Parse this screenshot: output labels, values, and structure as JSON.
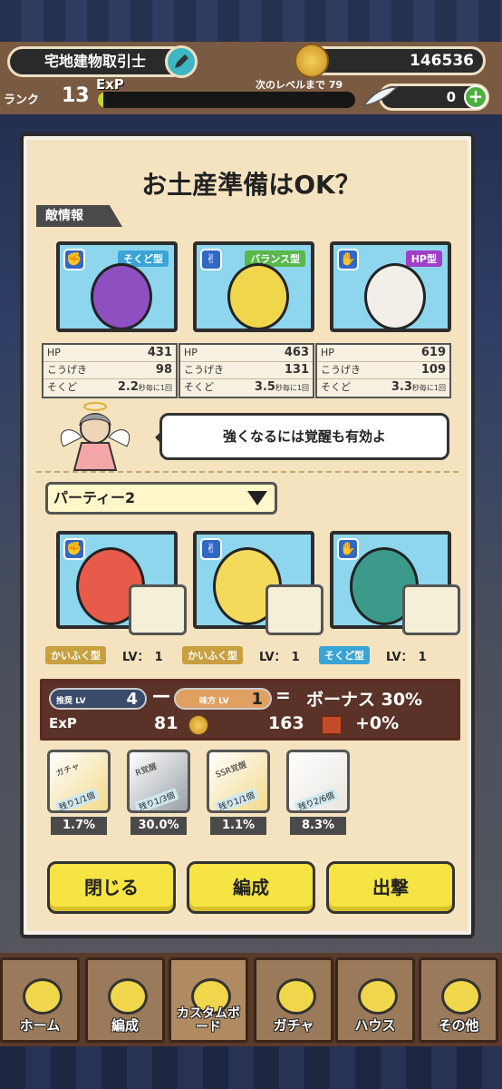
{
  "header": {
    "title": "宅地建物取引士",
    "coins": "146536",
    "rank_label": "ランク",
    "rank": "13",
    "exp_label": "ExP",
    "next_level_label": "次のレベルまで 79",
    "exp_progress": 0.02,
    "feathers": "0"
  },
  "modal": {
    "title": "お土産準備はOK？",
    "enemy_section": "敵情報",
    "enemies": [
      {
        "type": "そくど型",
        "type_color": "#3aa4d6",
        "hand": "✊",
        "hp": "431",
        "attack": "98",
        "speed": "2.2",
        "face_color": "#8e4fc1"
      },
      {
        "type": "バランス型",
        "type_color": "#58b84c",
        "hand": "✌",
        "hp": "463",
        "attack": "131",
        "speed": "3.5",
        "face_color": "#f0d64a"
      },
      {
        "type": "HP型",
        "type_color": "#a040c8",
        "hand": "✋",
        "hp": "619",
        "attack": "109",
        "speed": "3.3",
        "face_color": "#f2efe9"
      }
    ],
    "stat_labels": {
      "hp": "HP",
      "attack": "こうげき",
      "speed": "そくど",
      "speed_unit": "秒毎に1回"
    },
    "tip": "強くなるには覚醒も有効よ",
    "party_select": "パーティー2",
    "party": [
      {
        "type": "かいふく型",
        "type_color": "#c8a040",
        "lv_label": "LV：",
        "lv": "1",
        "hand": "✊",
        "face_color": "#e85a4a"
      },
      {
        "type": "かいふく型",
        "type_color": "#c8a040",
        "lv_label": "LV：",
        "lv": "1",
        "hand": "✌",
        "face_color": "#f3da5a"
      },
      {
        "type": "そくど型",
        "type_color": "#3aa4d6",
        "lv_label": "LV：",
        "lv": "1",
        "hand": "✋",
        "face_color": "#3c9a8a"
      }
    ],
    "bonus": {
      "recommend_label": "推奨 LV",
      "recommend_lv": "4",
      "ally_label": "味方 LV",
      "ally_lv": "1",
      "bonus_text": "ボーナス 30%",
      "exp_label": "ExP",
      "exp_value": "81",
      "coin_value": "163",
      "chest_bonus": "+0%"
    },
    "tickets": [
      {
        "name": "ガチャ",
        "count": "残り1/1個",
        "pct": "1.7%",
        "color": "#f2d98a"
      },
      {
        "name": "R覚醒",
        "count": "残り1/3個",
        "pct": "30.0%",
        "color": "#9aa0a8"
      },
      {
        "name": "SSR覚醒",
        "count": "残り1/1個",
        "pct": "1.1%",
        "color": "#f2d98a"
      },
      {
        "name": "",
        "count": "残り2/6個",
        "pct": "8.3%",
        "color": "#e9e6e0"
      }
    ],
    "buttons": {
      "close": "閉じる",
      "form": "編成",
      "sortie": "出撃"
    }
  },
  "nav": [
    {
      "label": "ホーム"
    },
    {
      "label": "編成"
    },
    {
      "label": "カスタムボード"
    },
    {
      "label": "ガチャ"
    },
    {
      "label": "ハウス"
    },
    {
      "label": "その他"
    }
  ]
}
